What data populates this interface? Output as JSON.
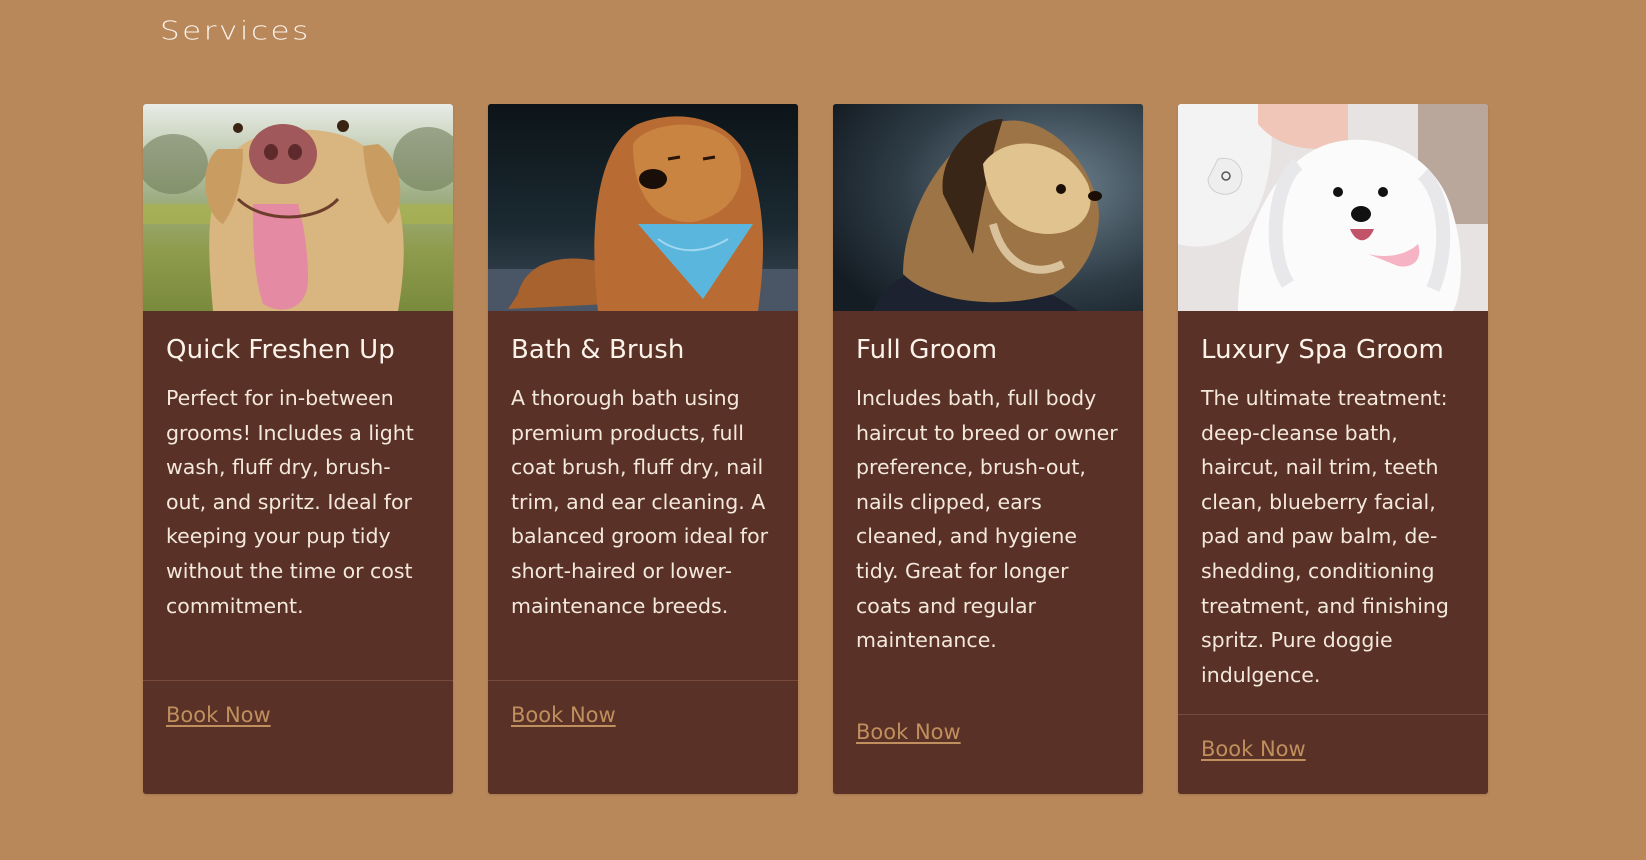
{
  "section": {
    "title": "Services"
  },
  "colors": {
    "page_background": "#b8875a",
    "card_background": "#5a3126",
    "link": "#c08f5e",
    "text": "#f6ece2"
  },
  "cards": [
    {
      "image": "labrador-photo",
      "title": "Quick Freshen Up",
      "description": "Perfect for in-between grooms! Includes a light wash, fluff dry, brush-out, and spritz. Ideal for keeping your pup tidy without the time or cost commitment.",
      "cta": "Book Now"
    },
    {
      "image": "chow-chow-photo",
      "title": "Bath & Brush",
      "description": "A thorough bath using premium products, full coat brush, fluff dry, nail trim, and ear cleaning. A balanced groom ideal for short-haired or lower-maintenance breeds.",
      "cta": "Book Now"
    },
    {
      "image": "long-haired-dog-photo",
      "title": "Full Groom",
      "description": "Includes bath, full body haircut to breed or owner preference, brush-out, nails clipped, ears cleaned, and hygiene tidy. Great for longer coats and regular maintenance.",
      "cta": "Book Now"
    },
    {
      "image": "white-maltese-photo",
      "title": "Luxury Spa Groom",
      "description": "The ultimate treatment: deep-cleanse bath, haircut, nail trim, teeth clean, blueberry facial, pad and paw balm, de-shedding, conditioning treatment, and finishing spritz. Pure doggie indulgence.",
      "cta": "Book Now"
    }
  ]
}
